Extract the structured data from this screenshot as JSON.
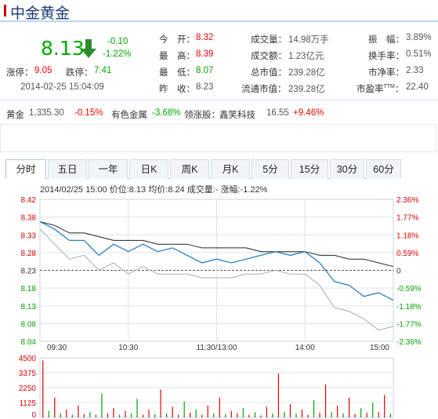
{
  "header": {
    "title": "中金黄金"
  },
  "quote": {
    "price": "8.13",
    "change": "-0.10",
    "change_pct": "-1.22%",
    "limit_up_label": "涨停：",
    "limit_up": "9.05",
    "limit_down_label": "跌停：",
    "limit_down": "7.41",
    "datetime": "2014-02-25  15:04:09"
  },
  "stats": {
    "open_label": "今　开：",
    "open": "8.32",
    "high_label": "最　高：",
    "high": "8.39",
    "low_label": "最　低：",
    "low": "8.07",
    "prev_label": "昨　收：",
    "prev": "8.23",
    "volume_label": "成交量：",
    "volume": "14.98万手",
    "turnover_label": "成交额：",
    "turnover": "1.23亿元",
    "mktcap_label": "总市值：",
    "mktcap": "239.28亿",
    "float_label": "流通市值：",
    "float_cap": "239.28亿",
    "amp_label": "振　幅：",
    "amp": "3.89%",
    "turn_rate_label": "换手率：",
    "turn_rate": "0.51%",
    "pb_label": "市净率：",
    "pb": "2.33",
    "pe_label": "市盈率",
    "pe_sup": "TTM",
    "pe_colon": "：",
    "pe": "22.40"
  },
  "sector": {
    "gold_label": "黄金",
    "gold_price": "1,335.30",
    "gold_chg": "-0.15%",
    "ind_label": "有色金属",
    "ind_chg": "-3.68%",
    "leader_label": "领涨股：",
    "leader_name": "鑫笑科技",
    "leader_price": "16.55",
    "leader_chg": "+9.46%"
  },
  "tabs": [
    {
      "label": "分时",
      "active": true
    },
    {
      "label": "五日"
    },
    {
      "label": "一年"
    },
    {
      "label": "日K"
    },
    {
      "label": "周K"
    },
    {
      "label": "月K"
    },
    {
      "label": "5分"
    },
    {
      "label": "15分"
    },
    {
      "label": "30分"
    },
    {
      "label": "60分"
    }
  ],
  "colors": {
    "price_line": "#2f7fbf",
    "avg_line": "#222222",
    "index_line": "#aaaaaa",
    "up": "#e00000",
    "down": "#00a000",
    "grid": "#dde3ea"
  },
  "chart_data": [
    {
      "type": "line",
      "info_line": "2014/02/25 15:00  价位:8.13 均价:8.24 成交量:- 涨幅:-1.22%",
      "y_ticks": [
        "8.42",
        "8.38",
        "8.33",
        "8.28",
        "8.23",
        "8.18",
        "8.13",
        "8.08",
        "8.04"
      ],
      "y2_ticks": [
        "2.36%",
        "1.77%",
        "1.18%",
        "0.59%",
        "0",
        "-0.59%",
        "-1.18%",
        "-1.77%",
        "-2.36%"
      ],
      "x_ticks": [
        "09:30",
        "10:30",
        "11:30/13:00",
        "14:00",
        "15:00"
      ],
      "ylim": [
        8.04,
        8.42
      ],
      "prev_close": 8.23,
      "x": [
        0,
        10,
        20,
        30,
        40,
        50,
        60,
        70,
        80,
        90,
        100,
        110,
        120,
        130,
        140,
        150,
        160,
        170,
        180,
        190,
        200,
        210,
        220,
        230,
        240
      ],
      "series": [
        {
          "key": "price",
          "values": [
            8.36,
            8.34,
            8.31,
            8.31,
            8.27,
            8.3,
            8.28,
            8.3,
            8.28,
            8.29,
            8.27,
            8.25,
            8.26,
            8.25,
            8.26,
            8.27,
            8.28,
            8.27,
            8.28,
            8.25,
            8.2,
            8.19,
            8.16,
            8.17,
            8.15
          ]
        },
        {
          "key": "avg",
          "values": [
            8.36,
            8.35,
            8.33,
            8.33,
            8.32,
            8.31,
            8.31,
            8.31,
            8.3,
            8.3,
            8.3,
            8.29,
            8.29,
            8.29,
            8.29,
            8.28,
            8.28,
            8.28,
            8.28,
            8.27,
            8.27,
            8.26,
            8.26,
            8.25,
            8.24
          ]
        },
        {
          "key": "index",
          "values": [
            8.34,
            8.3,
            8.26,
            8.27,
            8.23,
            8.25,
            8.22,
            8.24,
            8.22,
            8.22,
            8.22,
            8.21,
            8.21,
            8.21,
            8.22,
            8.22,
            8.23,
            8.22,
            8.22,
            8.19,
            8.13,
            8.12,
            8.1,
            8.07,
            8.08
          ]
        }
      ]
    },
    {
      "type": "bar",
      "y_ticks": [
        "4500",
        "3375",
        "2250",
        "1125",
        "0"
      ],
      "ylim": [
        0,
        4500
      ],
      "values": [
        4300,
        500,
        1500,
        300,
        600,
        200,
        900,
        250,
        400,
        200,
        1800,
        300,
        700,
        200,
        500,
        300,
        1400,
        200,
        600,
        250,
        2100,
        300,
        800,
        200,
        1200,
        350,
        600,
        200,
        900,
        300,
        1500,
        250,
        500,
        300,
        700,
        200,
        400,
        150,
        800,
        300,
        3300,
        400,
        1000,
        300,
        600,
        200,
        1300,
        350,
        2500,
        400,
        900,
        300,
        1500,
        250,
        700,
        350,
        1100,
        400,
        1700,
        300
      ],
      "up": [
        1,
        0,
        1,
        0,
        1,
        0,
        1,
        1,
        0,
        1,
        0,
        1,
        1,
        0,
        1,
        0,
        0,
        1,
        1,
        0,
        1,
        0,
        1,
        1,
        0,
        1,
        0,
        1,
        1,
        0,
        1,
        0,
        1,
        1,
        0,
        1,
        0,
        1,
        1,
        0,
        1,
        0,
        1,
        0,
        1,
        1,
        0,
        1,
        1,
        0,
        1,
        0,
        1,
        1,
        0,
        1,
        0,
        1,
        1,
        0
      ]
    }
  ]
}
